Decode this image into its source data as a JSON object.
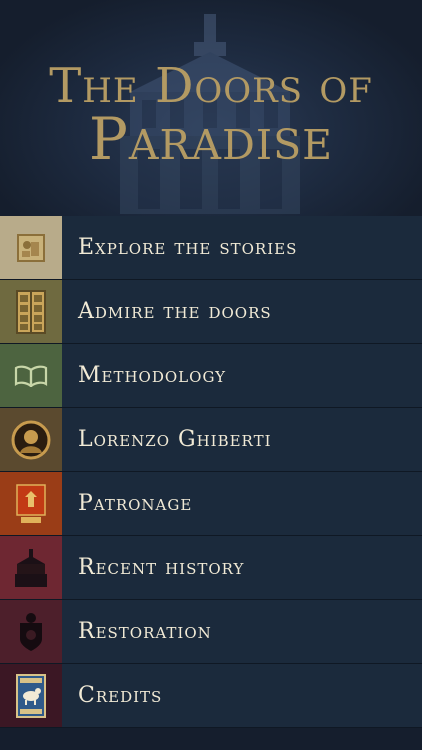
{
  "header": {
    "title_line1": "The Doors of",
    "title_line2": "Paradise",
    "background_icon": "baptistery-image"
  },
  "menu": {
    "items": [
      {
        "label": "Explore the stories",
        "icon": "relief-panel-thumbnail",
        "color": "#b8ab8a"
      },
      {
        "label": "Admire the doors",
        "icon": "doors-thumbnail",
        "color": "#6f6a40"
      },
      {
        "label": "Methodology",
        "icon": "open-book-thumbnail",
        "color": "#4d6440"
      },
      {
        "label": "Lorenzo Ghiberti",
        "icon": "portrait-medallion-thumbnail",
        "color": "#5b4a2f"
      },
      {
        "label": "Patronage",
        "icon": "guild-emblem-thumbnail",
        "color": "#9a3d17"
      },
      {
        "label": "Recent history",
        "icon": "baptistery-thumbnail",
        "color": "#6e2732"
      },
      {
        "label": "Restoration",
        "icon": "coat-of-arms-thumbnail",
        "color": "#4d1f2b"
      },
      {
        "label": "Credits",
        "icon": "lamb-emblem-thumbnail",
        "color": "#3b1724"
      }
    ]
  }
}
